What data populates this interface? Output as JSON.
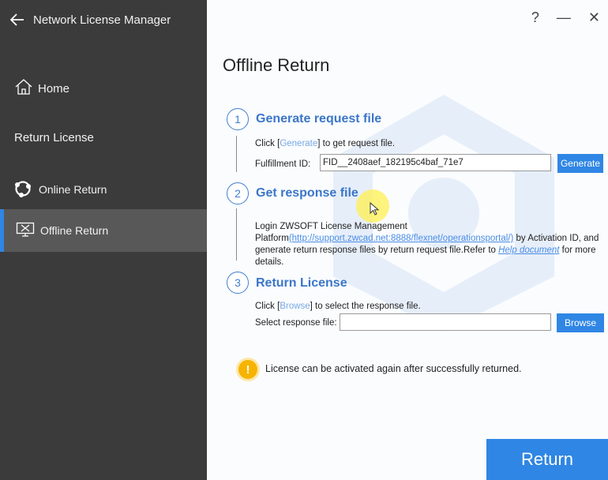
{
  "sidebar": {
    "app_title": "Network License Manager",
    "home_label": "Home",
    "section_label": "Return License",
    "items": [
      {
        "label": "Online Return"
      },
      {
        "label": "Offline Return"
      }
    ],
    "colors": {
      "background": "#3b3b3b",
      "active": "#585858",
      "accent": "#2f86e4"
    }
  },
  "window": {
    "help_label": "?",
    "minimize_label": "—",
    "close_label": "✕"
  },
  "main": {
    "page_title": "Offline Return",
    "steps": [
      {
        "number": "1",
        "title": "Generate request file",
        "hint_prefix": "Click [",
        "hint_action": "Generate",
        "hint_suffix": "] to get request file.",
        "field_label": "Fulfillment ID:",
        "field_value": "FID__2408aef_182195c4baf_71e7",
        "button_label": "Generate"
      },
      {
        "number": "2",
        "title": "Get response file",
        "text_prefix": "Login ZWSOFT License Management Platform",
        "link_text": "(http://support.zwcad.net:8888/flexnet/operationsportal/)",
        "text_middle": " by Activation ID, and generate return response files by return request file.Refer to ",
        "help_link": "Help document",
        "text_suffix": " for more details."
      },
      {
        "number": "3",
        "title": "Return License",
        "hint_prefix": "Click [",
        "hint_action": "Browse",
        "hint_suffix": "] to select the response file.",
        "field_label": "Select response file:",
        "field_value": "",
        "button_label": "Browse"
      }
    ],
    "warning_icon": "!",
    "warning_text": "License can be activated again after successfully returned.",
    "return_button": "Return"
  }
}
